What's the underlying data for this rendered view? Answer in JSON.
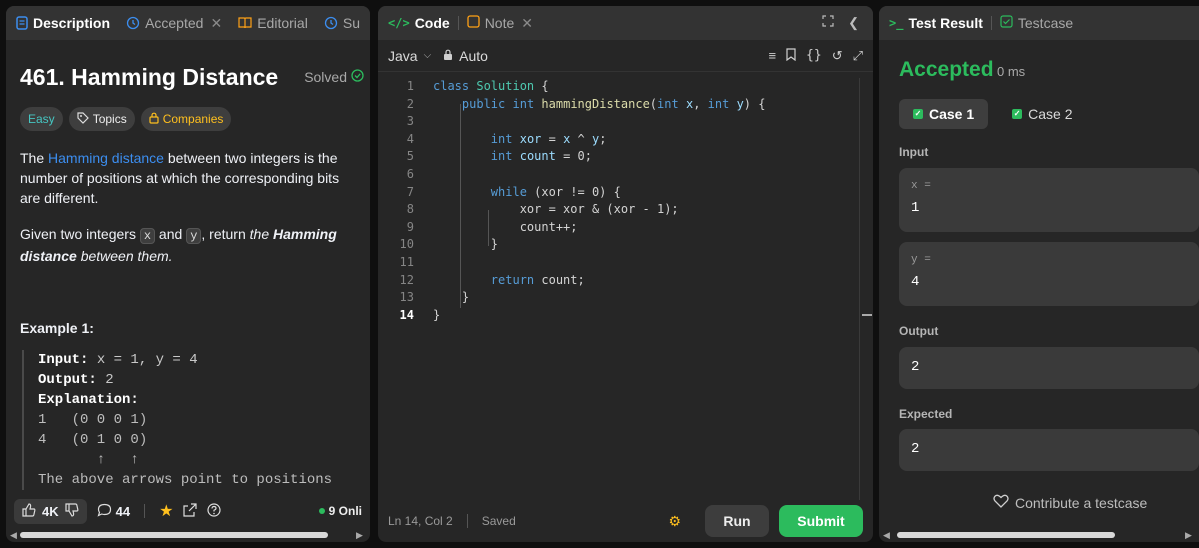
{
  "left": {
    "tabs": [
      {
        "label": "Description"
      },
      {
        "label": "Accepted"
      },
      {
        "label": "Editorial"
      },
      {
        "label": "Su"
      }
    ],
    "title": "461. Hamming Distance",
    "solved": "Solved",
    "chips": {
      "difficulty": "Easy",
      "topics": "Topics",
      "companies": "Companies"
    },
    "description": {
      "p1_prefix": "The ",
      "p1_link": "Hamming distance",
      "p1_rest": " between two integers is the number of positions at which the corresponding bits are different.",
      "p2_prefix": "Given two integers ",
      "var_x": "x",
      "p2_and": " and ",
      "var_y": "y",
      "p2_mid": ", return ",
      "p2_em1": "the ",
      "p2_strong": "Hamming distance",
      "p2_em2": " between them."
    },
    "example": {
      "title": "Example 1:",
      "input_label": "Input:",
      "input_value": " x = 1, y = 4",
      "output_label": "Output:",
      "output_value": " 2",
      "explanation_label": "Explanation:",
      "lines": [
        "1   (0 0 0 1)",
        "4   (0 1 0 0)",
        "       ↑   ↑",
        "The above arrows point to positions"
      ]
    },
    "bottom": {
      "likes": "4K",
      "comments": "44",
      "online": "9 Onli"
    }
  },
  "mid": {
    "tabs": [
      {
        "label": "Code"
      },
      {
        "label": "Note"
      }
    ],
    "language": "Java",
    "mode": "Auto",
    "code_lines": [
      "class Solution {",
      "    public int hammingDistance(int x, int y) {",
      "",
      "        int xor = x ^ y;",
      "        int count = 0;",
      "",
      "        while (xor != 0) {",
      "            xor = xor & (xor - 1);",
      "            count++;",
      "        }",
      "",
      "        return count;",
      "    }",
      "}"
    ],
    "line_numbers": [
      "1",
      "2",
      "3",
      "4",
      "5",
      "6",
      "7",
      "8",
      "9",
      "10",
      "11",
      "12",
      "13",
      "14"
    ],
    "status": {
      "cursor": "Ln 14, Col 2",
      "saved": "Saved"
    },
    "run": "Run",
    "submit": "Submit"
  },
  "right": {
    "tabs": [
      {
        "label": "Test Result"
      },
      {
        "label": "Testcase"
      }
    ],
    "result": "Accepted",
    "runtime": "0 ms",
    "cases": [
      "Case 1",
      "Case 2"
    ],
    "input_label": "Input",
    "x_key": "x =",
    "x_val": "1",
    "y_key": "y =",
    "y_val": "4",
    "output_label": "Output",
    "output_val": "2",
    "expected_label": "Expected",
    "expected_val": "2",
    "contribute": "Contribute a testcase"
  },
  "colors": {
    "accent_green": "#2cbb5d",
    "link_blue": "#3c8ef0",
    "easy_teal": "#46c6c2",
    "companies_yellow": "#ffc01e"
  }
}
